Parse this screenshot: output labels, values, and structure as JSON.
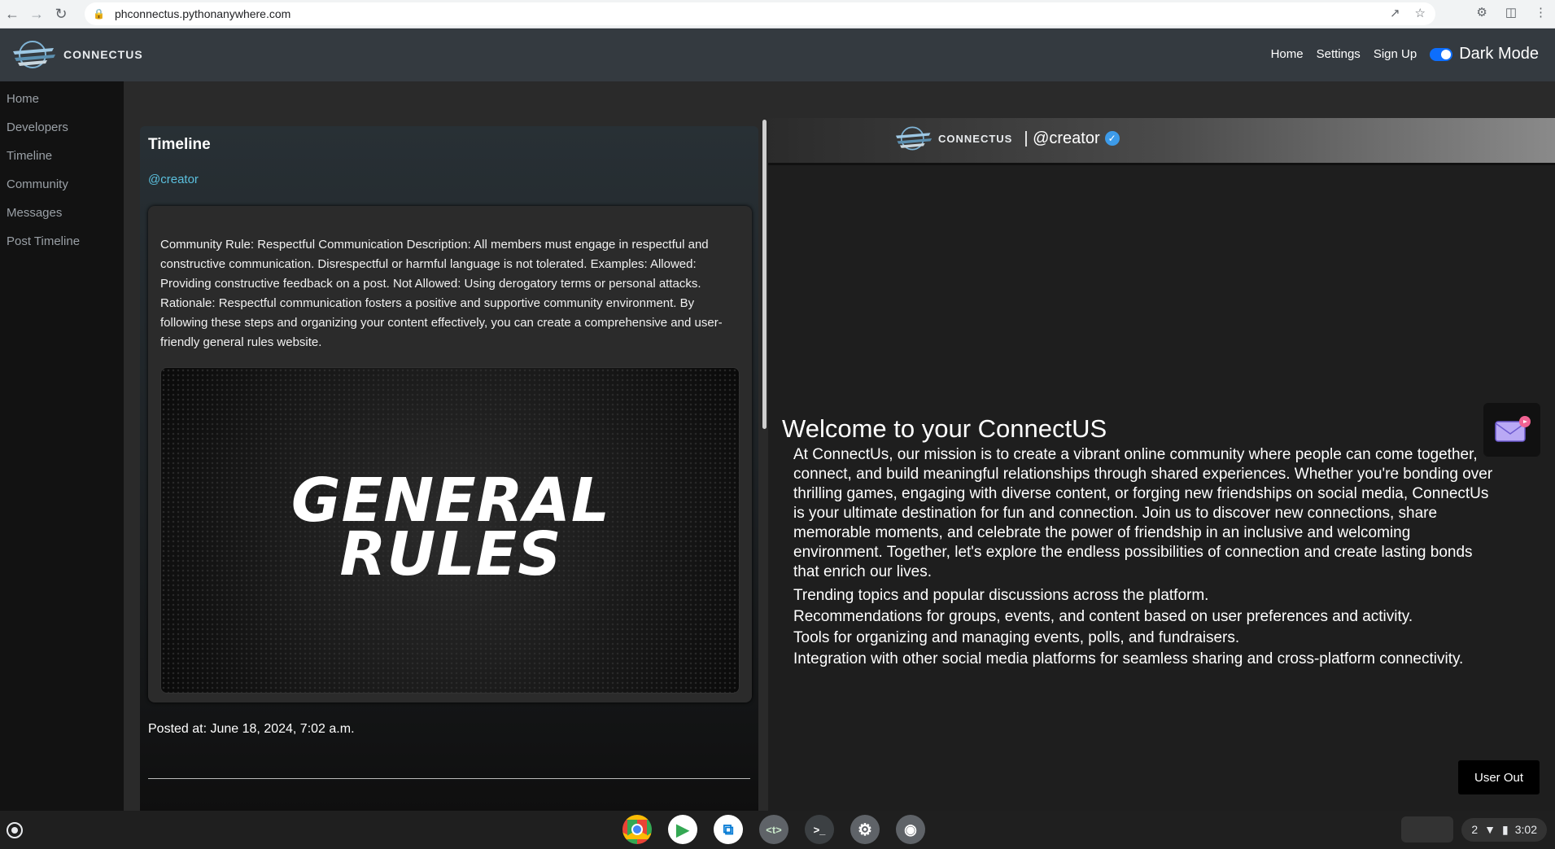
{
  "browser": {
    "url": "phconnectus.pythonanywhere.com",
    "icons": [
      "back-icon",
      "forward-icon",
      "reload-icon",
      "lock-icon",
      "share-icon",
      "star-icon",
      "extensions-icon",
      "sidepanel-icon",
      "menu-icon"
    ]
  },
  "header": {
    "logo_text": "CONNECTUS",
    "nav": [
      "Home",
      "Settings",
      "Sign Up"
    ],
    "dark_mode_label": "Dark Mode",
    "dark_mode_on": true
  },
  "sidebar": {
    "items": [
      {
        "label": "Home"
      },
      {
        "label": "Developers"
      },
      {
        "label": "Timeline"
      },
      {
        "label": "Community"
      },
      {
        "label": "Messages"
      },
      {
        "label": "Post Timeline"
      }
    ]
  },
  "timeline": {
    "title": "Timeline",
    "post": {
      "author": "@creator",
      "body": "Community Rule: Respectful Communication Description: All members must engage in respectful and constructive communication. Disrespectful or harmful language is not tolerated. Examples: Allowed: Providing constructive feedback on a post. Not Allowed: Using derogatory terms or personal attacks. Rationale: Respectful communication fosters a positive and supportive community environment. By following these steps and organizing your content effectively, you can create a comprehensive and user-friendly general rules website.",
      "image_text_line1": "GENERAL",
      "image_text_line2": "RULES",
      "posted_at": "Posted at: June 18, 2024, 7:02 a.m."
    }
  },
  "profile": {
    "logo_text": "CONNECTUS",
    "handle": "| @creator",
    "verified": true
  },
  "welcome": {
    "title": "Welcome to your ConnectUS",
    "paragraph": "At ConnectUs, our mission is to create a vibrant online community where people can come together, connect, and build meaningful relationships through shared experiences. Whether you're bonding over thrilling games, engaging with diverse content, or forging new friendships on social media, ConnectUs is your ultimate destination for fun and connection. Join us to discover new connections, share memorable moments, and celebrate the power of friendship in an inclusive and welcoming environment. Together, let's explore the endless possibilities of connection and create lasting bonds that enrich our lives.",
    "features": [
      "Trending topics and popular discussions across the platform.",
      "Recommendations for groups, events, and content based on user preferences and activity.",
      "Tools for organizing and managing events, polls, and fundraisers.",
      "Integration with other social media platforms for seamless sharing and cross-platform connectivity."
    ],
    "user_out_label": "User Out"
  },
  "taskbar": {
    "apps": [
      "chrome-icon",
      "play-store-icon",
      "vscode-icon",
      "text-editor-icon",
      "terminal-icon",
      "settings-icon",
      "penguin-icon"
    ],
    "notification_count": "2",
    "time": "3:02"
  },
  "colors": {
    "header_bg": "#343a40",
    "accent": "#0d6efd",
    "handle_link": "#5bc0de",
    "verified": "#3d9be9"
  }
}
